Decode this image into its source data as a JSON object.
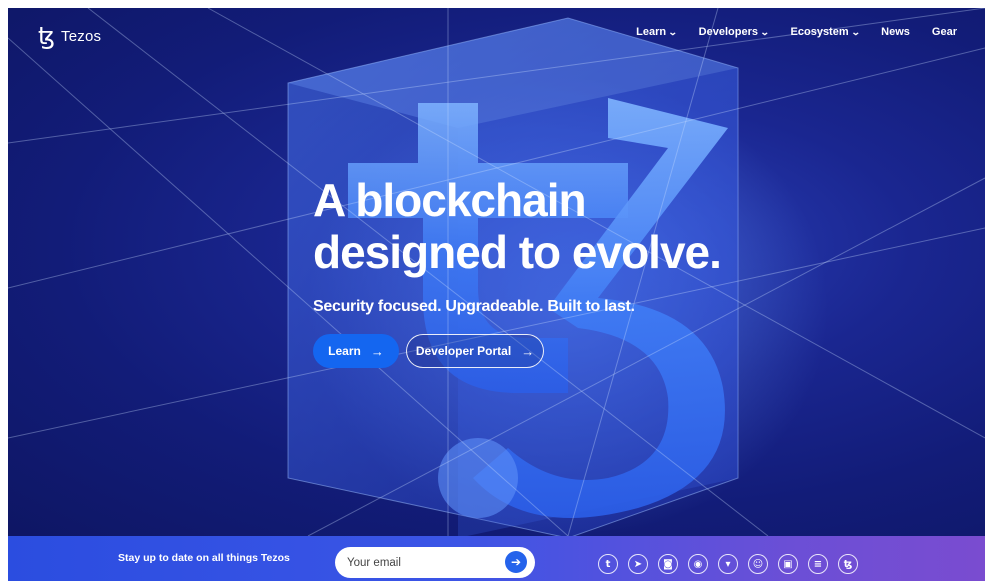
{
  "brand": {
    "glyph": "ꜩ",
    "name": "Tezos"
  },
  "nav": {
    "items": [
      {
        "label": "Learn",
        "dropdown": true
      },
      {
        "label": "Developers",
        "dropdown": true
      },
      {
        "label": "Ecosystem",
        "dropdown": true
      },
      {
        "label": "News",
        "dropdown": false
      },
      {
        "label": "Gear",
        "dropdown": false
      }
    ],
    "chevron": "⌄"
  },
  "hero": {
    "headline_line1": "A blockchain",
    "headline_line2": "designed to evolve.",
    "subheadline": "Security focused. Upgradeable. Built to last.",
    "primary_button": "Learn",
    "secondary_button": "Developer Portal",
    "arrow": "→"
  },
  "newsletter": {
    "text": "Stay up to date on all things Tezos",
    "email_placeholder": "Your email",
    "submit_icon": "➔"
  },
  "socials": [
    {
      "name": "twitter-icon",
      "glyph": "t"
    },
    {
      "name": "telegram-icon",
      "glyph": "➤"
    },
    {
      "name": "discord-icon",
      "glyph": "◙"
    },
    {
      "name": "github-icon",
      "glyph": "◉"
    },
    {
      "name": "gitlab-icon",
      "glyph": "▾"
    },
    {
      "name": "reddit-icon",
      "glyph": "☺"
    },
    {
      "name": "medium-icon",
      "glyph": "▣"
    },
    {
      "name": "stack-icon",
      "glyph": "≡"
    },
    {
      "name": "tezos-icon",
      "glyph": "ꜩ"
    }
  ],
  "colors": {
    "hero_bg": "#141d7a",
    "primary_button": "#1466f0",
    "footer_start": "#2b4de0",
    "footer_end": "#7a4cd0"
  }
}
